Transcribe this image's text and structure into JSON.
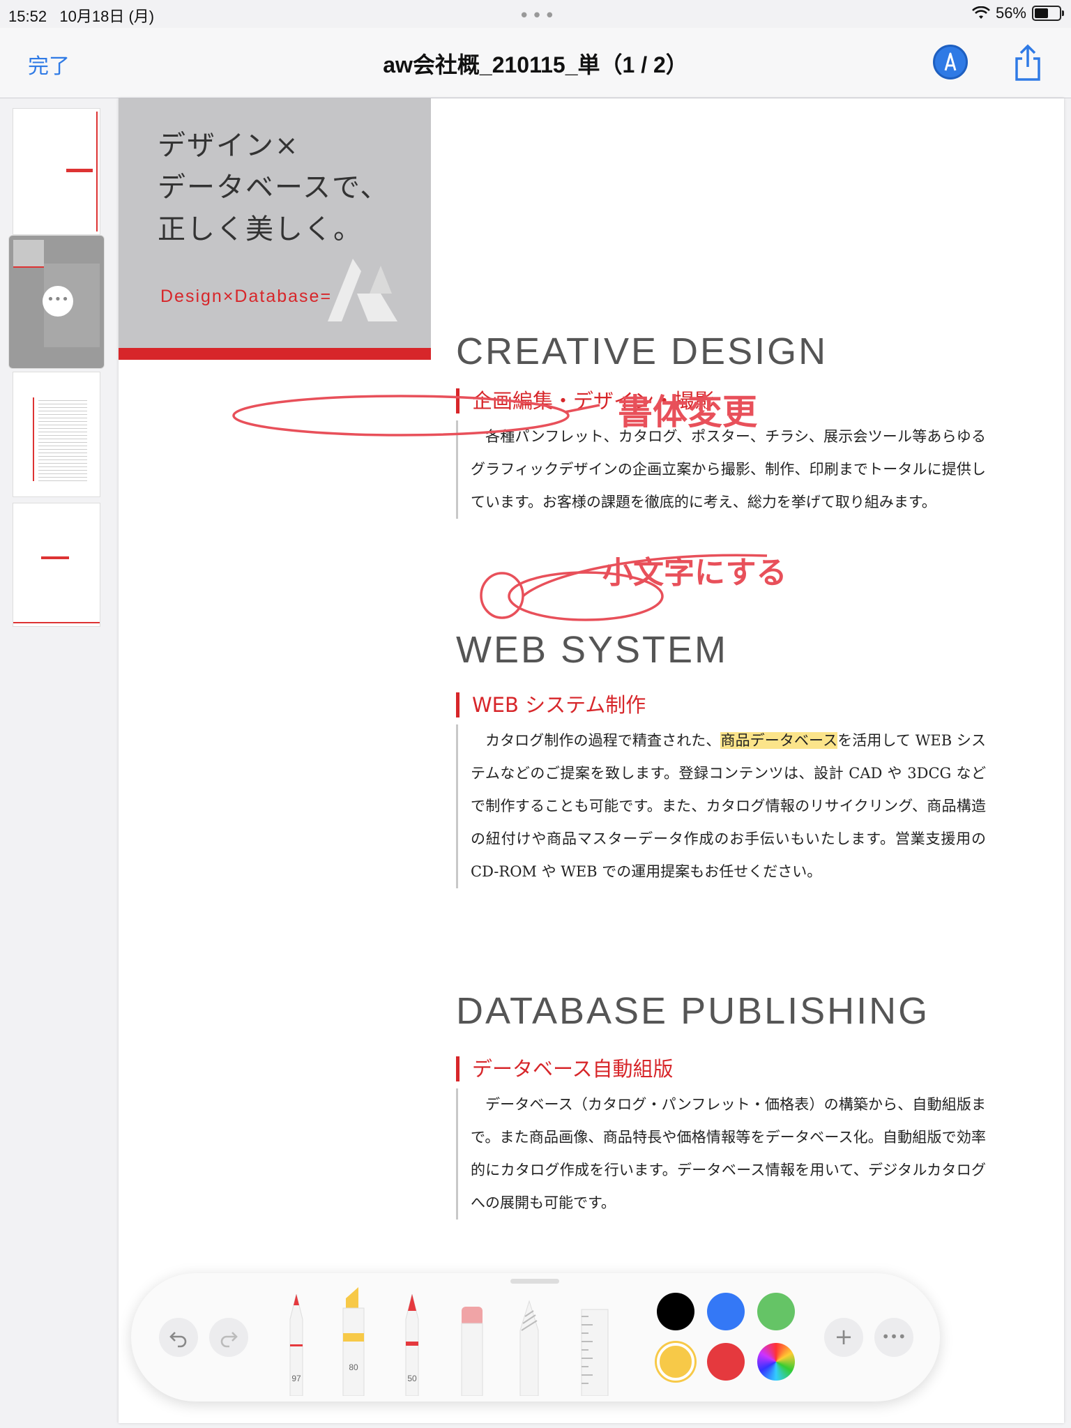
{
  "status_bar": {
    "time": "15:52",
    "date": "10月18日 (月)",
    "battery_percent": "56%",
    "battery_level": 0.56
  },
  "nav": {
    "done_label": "完了",
    "title": "aw会社概_210115_単（1 / 2）"
  },
  "hero": {
    "headline": "デザイン×\nデータベースで、\n正しく美しく。",
    "subline": "Design×Database="
  },
  "sections": [
    {
      "heading": "CREATIVE DESIGN",
      "subheading": "企画編集・デザイン・撮影",
      "body": "各種パンフレット、カタログ、ポスター、チラシ、展示会ツール等あらゆるグラフィックデザインの企画立案から撮影、制作、印刷までトータルに提供しています。お客様の課題を徹底的に考え、総力を挙げて取り組みます。"
    },
    {
      "heading": "WEB SYSTEM",
      "subheading": "WEB システム制作",
      "body_before": "カタログ制作の過程で精査された、",
      "body_highlight": "商品データベース",
      "body_after": "を活用して WEB システムなどのご提案を致します。登録コンテンツは、設計 CAD や 3DCG などで制作することも可能です。また、カタログ情報のリサイクリング、商品構造の紐付けや商品マスターデータ作成のお手伝いもいたします。営業支援用の CD-ROM や WEB での運用提案もお任せください。"
    },
    {
      "heading": "DATABASE PUBLISHING",
      "subheading": "データベース自動組版",
      "body": "データベース（カタログ・パンフレット・価格表）の構築から、自動組版まで。また商品画像、商品特長や価格情報等をデータベース化。自動組版で効率的にカタログ作成を行います。データベース情報を用いて、デジタルカタログへの展開も可能です。"
    }
  ],
  "annotations": {
    "note1": "書体変更",
    "note2": "小文字にする"
  },
  "toolbar": {
    "undo_icon": "undo-icon",
    "redo_icon": "redo-icon",
    "pen_width": "97",
    "marker_width": "80",
    "pencil_width": "50",
    "add_label": "+",
    "more_label": "•••",
    "colors": [
      "#000000",
      "#3478f6",
      "#65c466",
      "#f7c948",
      "#e5393e"
    ],
    "selected_color": "#f7c948"
  }
}
